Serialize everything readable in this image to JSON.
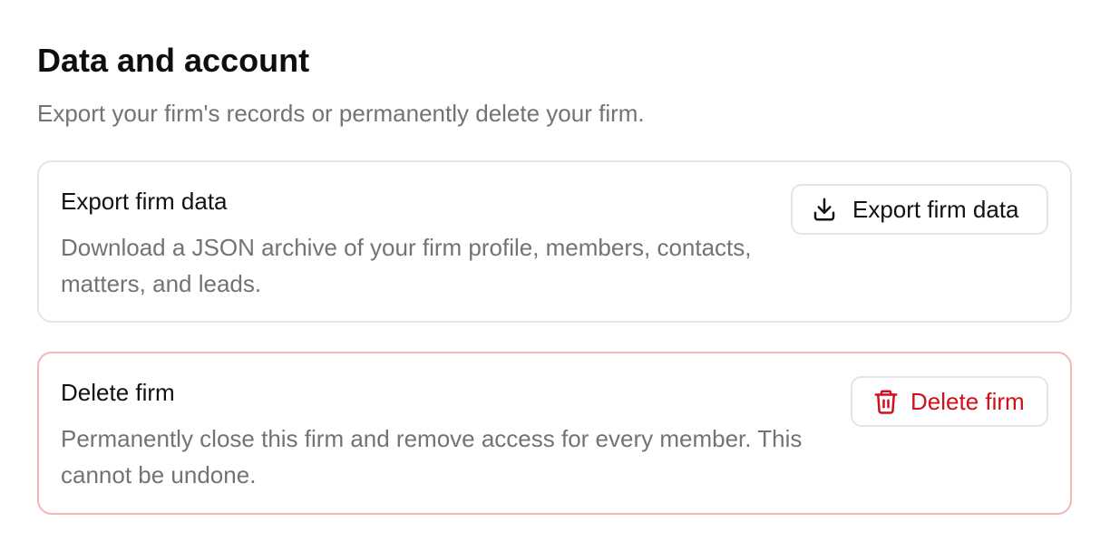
{
  "section": {
    "title": "Data and account",
    "description": "Export your firm's records or permanently delete your firm."
  },
  "export_card": {
    "title": "Export firm data",
    "description": "Download a JSON archive of your firm profile, members, contacts, matters, and leads.",
    "button_label": "Export firm data",
    "button_icon": "download-icon"
  },
  "delete_card": {
    "title": "Delete firm",
    "description": "Permanently close this firm and remove access for every member. This cannot be undone.",
    "button_label": "Delete firm",
    "button_icon": "trash-icon"
  },
  "colors": {
    "danger": "#d0101b",
    "danger_border": "#f1b8b8",
    "muted_text": "#737373",
    "border": "#e5e5e5"
  }
}
